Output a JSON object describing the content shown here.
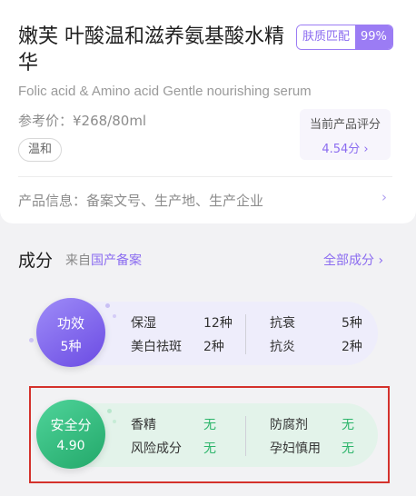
{
  "product": {
    "title": "嫩芙 叶酸温和滋养氨基酸水精华",
    "match_label": "肤质匹配",
    "match_value": "99%",
    "english_name": "Folic acid &  Amino acid Gentle nourishing serum",
    "price": "参考价：¥268/80ml",
    "tag": "温和",
    "rating_label": "当前产品评分",
    "rating_value": "4.54分 ›",
    "info": "产品信息：备案文号、生产地、生产企业",
    "info_arrow": "›"
  },
  "ingredients": {
    "title": "成分",
    "source_prefix": "来自",
    "source_link": "国产备案",
    "all_link": "全部成分 ›"
  },
  "function_card": {
    "label": "功效",
    "count": "5种",
    "items": [
      {
        "name": "保湿",
        "value": "12种"
      },
      {
        "name": "美白祛斑",
        "value": "2种"
      },
      {
        "name": "抗衰",
        "value": "5种"
      },
      {
        "name": "抗炎",
        "value": "2种"
      }
    ]
  },
  "safety_card": {
    "label": "安全分",
    "score": "4.90",
    "items": [
      {
        "name": "香精",
        "value": "无"
      },
      {
        "name": "风险成分",
        "value": "无"
      },
      {
        "name": "防腐剂",
        "value": "无"
      },
      {
        "name": "孕妇慎用",
        "value": "无"
      }
    ]
  },
  "colors": {
    "accent": "#8b6cf0",
    "safe": "#2db56b",
    "highlight": "#d4322c"
  }
}
